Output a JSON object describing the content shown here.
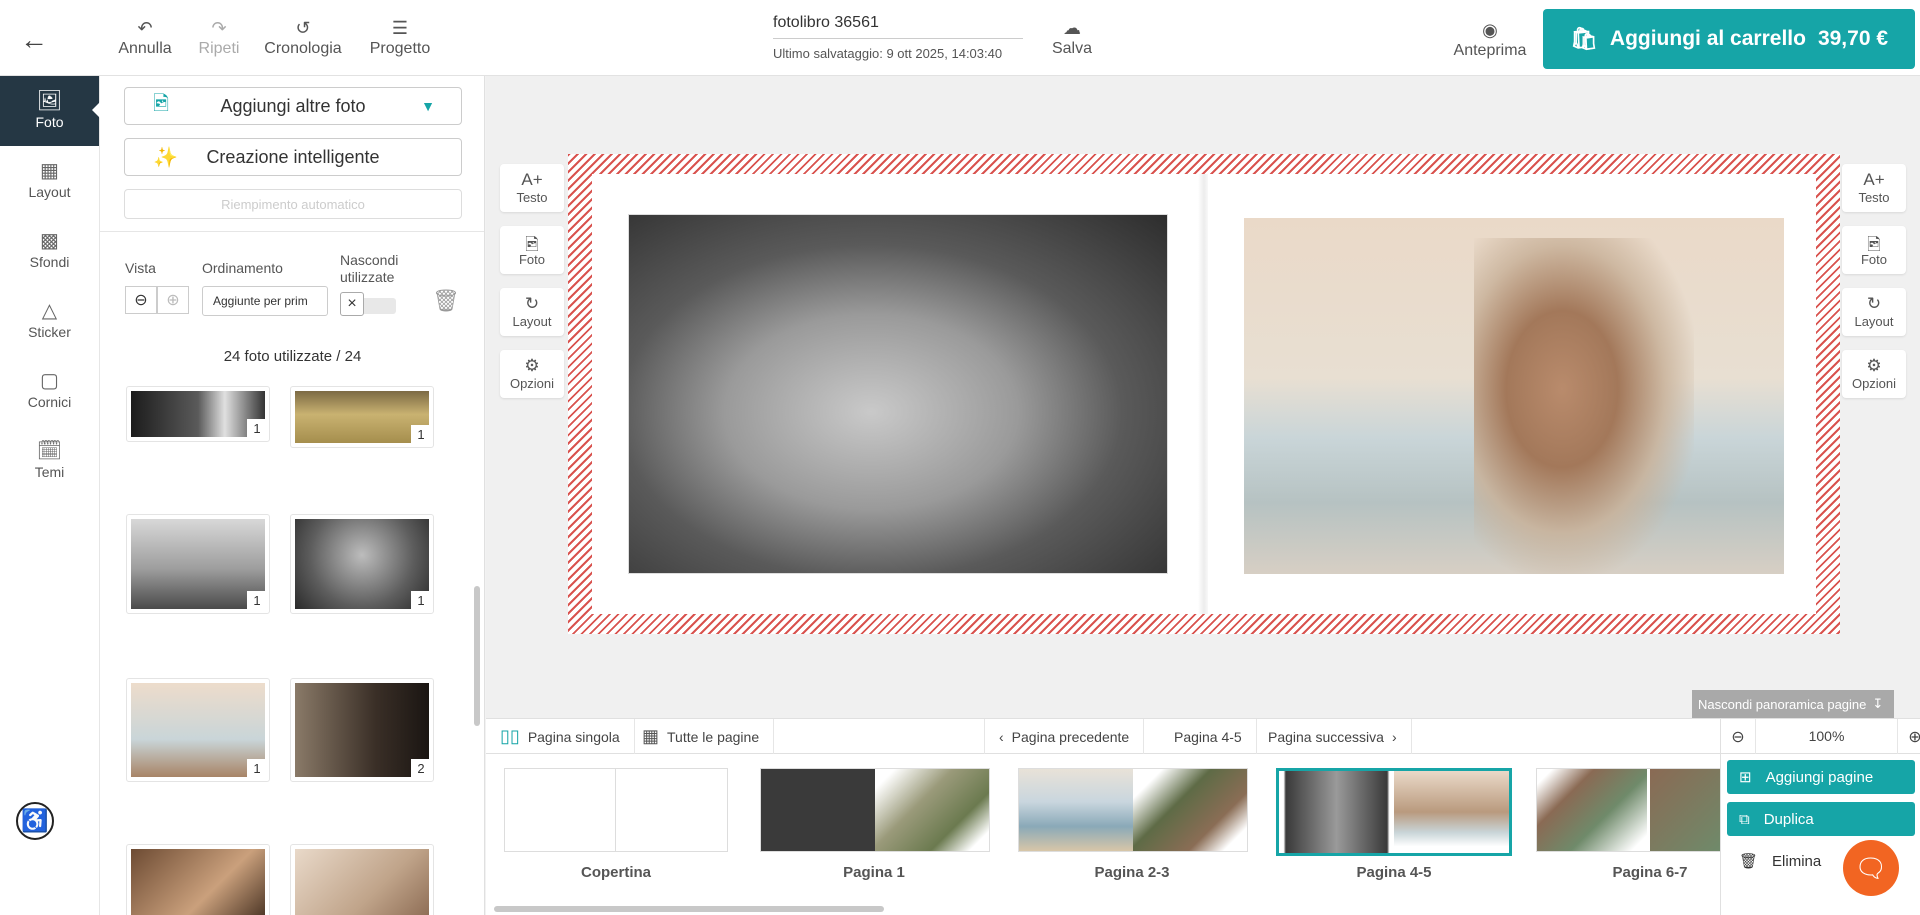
{
  "header": {
    "undo_label": "Annulla",
    "redo_label": "Ripeti",
    "history_label": "Cronologia",
    "project_label": "Progetto",
    "project_name": "fotolibro 36561",
    "last_saved": "Ultimo salvataggio:  9 ott 2025, 14:03:40",
    "save_label": "Salva",
    "preview_label": "Anteprima",
    "cart_label": "Aggiungi al carrello",
    "cart_price": "39,70 €"
  },
  "sidebar": {
    "items": [
      {
        "label": "Foto",
        "icon": "photo-icon"
      },
      {
        "label": "Layout",
        "icon": "layout-icon"
      },
      {
        "label": "Sfondi",
        "icon": "background-icon"
      },
      {
        "label": "Sticker",
        "icon": "sticker-icon"
      },
      {
        "label": "Cornici",
        "icon": "frame-icon"
      },
      {
        "label": "Temi",
        "icon": "theme-icon"
      }
    ]
  },
  "photos_panel": {
    "add_more_label": "Aggiungi altre foto",
    "smart_create_label": "Creazione intelligente",
    "autofill_label": "Riempimento automatico",
    "view_label": "Vista",
    "sort_label": "Ordinamento",
    "sort_value": "Aggiunte per prim",
    "hide_used_label_1": "Nascondi",
    "hide_used_label_2": "utilizzate",
    "used_count": "24 foto utilizzate / 24",
    "thumbs": [
      {
        "badge": "1"
      },
      {
        "badge": "1"
      },
      {
        "badge": "1"
      },
      {
        "badge": "1"
      },
      {
        "badge": "1"
      },
      {
        "badge": "2"
      },
      {
        "badge": ""
      },
      {
        "badge": ""
      }
    ]
  },
  "canvas_tools": {
    "text_label": "Testo",
    "photo_label": "Foto",
    "layout_label": "Layout",
    "options_label": "Opzioni"
  },
  "page_toolbar": {
    "single_page": "Pagina singola",
    "all_pages": "Tutte le pagine",
    "prev_page": "Pagina precedente",
    "current_page": "Pagina 4-5",
    "next_page": "Pagina successiva",
    "zoom": "100%",
    "hide_overview": "Nascondi panoramica pagine"
  },
  "spreads": [
    {
      "label": "Copertina"
    },
    {
      "label": "Pagina 1"
    },
    {
      "label": "Pagina 2-3"
    },
    {
      "label": "Pagina 4-5"
    },
    {
      "label": "Pagina 6-7"
    }
  ],
  "page_actions": {
    "add_pages": "Aggiungi pagine",
    "duplicate": "Duplica",
    "delete": "Elimina"
  },
  "colors": {
    "accent": "#16a5a7",
    "rail_active": "#253744",
    "bleed_hatch": "#d9534f",
    "chat": "#f26522"
  }
}
